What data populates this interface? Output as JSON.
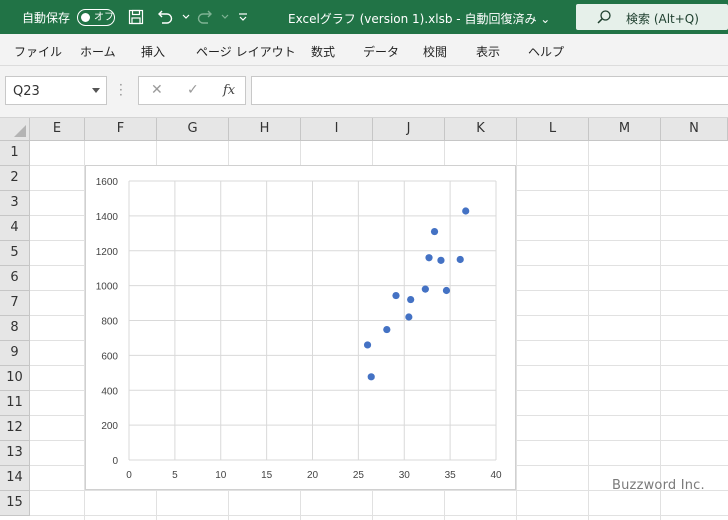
{
  "titlebar": {
    "autosave_label": "自動保存",
    "autosave_state": "オフ",
    "document_title": "Excelグラフ (version 1).xlsb  -  自動回復済み  ⌄",
    "search_label": "検索 (Alt+Q)"
  },
  "ribbon": {
    "tabs": [
      "ファイル",
      "ホーム",
      "挿入",
      "ページ レイアウト",
      "数式",
      "データ",
      "校閲",
      "表示",
      "ヘルプ"
    ]
  },
  "formula_bar": {
    "name_box": "Q23",
    "cancel_symbol": "✕",
    "enter_symbol": "✓",
    "fx_label": "fx",
    "formula_value": ""
  },
  "sheet": {
    "columns": [
      "E",
      "F",
      "G",
      "H",
      "I",
      "J",
      "K",
      "L",
      "M",
      "N"
    ],
    "rows": [
      "1",
      "2",
      "3",
      "4",
      "5",
      "6",
      "7",
      "8",
      "9",
      "10",
      "11",
      "12",
      "13",
      "14",
      "15"
    ]
  },
  "chart_data": {
    "type": "scatter",
    "xlim": [
      0,
      40
    ],
    "ylim": [
      0,
      1600
    ],
    "x_ticks": [
      0,
      5,
      10,
      15,
      20,
      25,
      30,
      35,
      40
    ],
    "y_ticks": [
      0,
      200,
      400,
      600,
      800,
      1000,
      1200,
      1400,
      1600
    ],
    "grid": true,
    "legend": "none",
    "series": [
      {
        "color": "#4472c4",
        "points": [
          [
            26.0,
            660
          ],
          [
            26.4,
            477
          ],
          [
            28.1,
            748
          ],
          [
            29.1,
            943
          ],
          [
            30.5,
            820
          ],
          [
            30.7,
            920
          ],
          [
            32.3,
            980
          ],
          [
            32.7,
            1160
          ],
          [
            33.3,
            1310
          ],
          [
            34.0,
            1145
          ],
          [
            34.6,
            972
          ],
          [
            36.1,
            1150
          ],
          [
            36.7,
            1428
          ]
        ]
      }
    ]
  },
  "watermark": "Buzzword Inc.",
  "colors": {
    "titlebar": "#217346",
    "marker": "#4472c4"
  }
}
